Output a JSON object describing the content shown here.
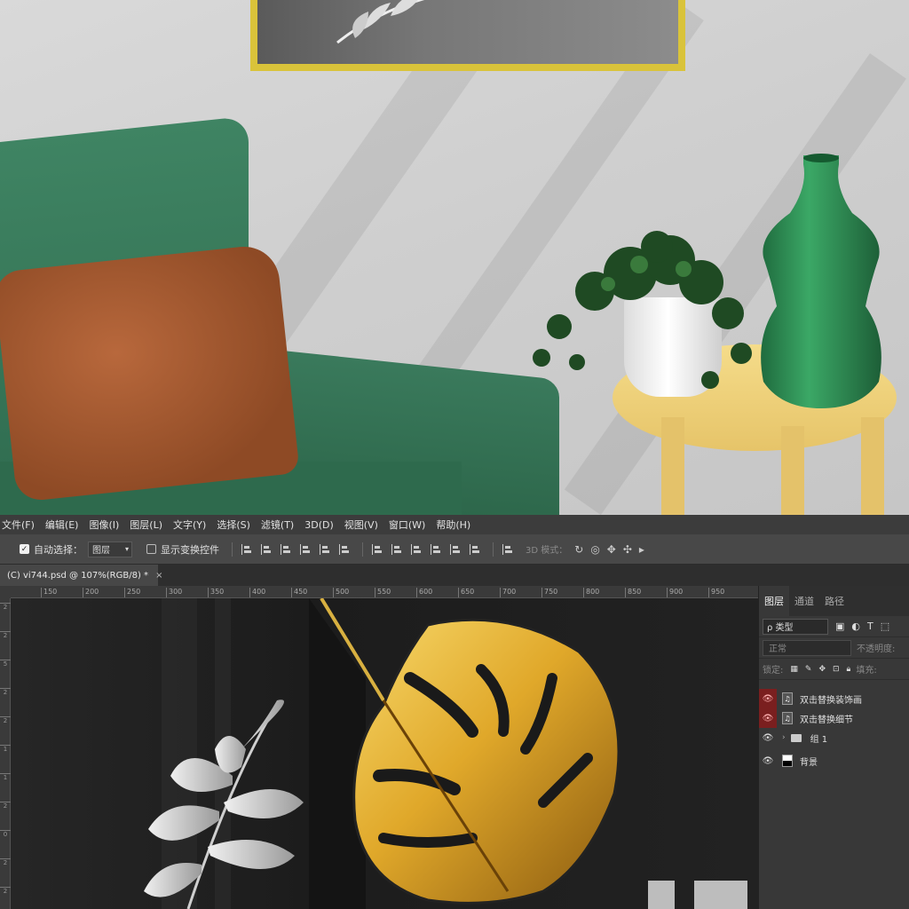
{
  "menu": [
    "文件(F)",
    "编辑(E)",
    "图像(I)",
    "图层(L)",
    "文字(Y)",
    "选择(S)",
    "滤镜(T)",
    "3D(D)",
    "视图(V)",
    "窗口(W)",
    "帮助(H)"
  ],
  "options": {
    "auto_select_label": "自动选择：",
    "auto_select_value": "图层",
    "show_transform_label": "显示变换控件",
    "mode_label": "3D 模式："
  },
  "document_tab": {
    "title": "(C) vi744.psd @ 107%(RGB/8) *",
    "close": "×"
  },
  "ruler": {
    "horizontal": [
      "150",
      "200",
      "250",
      "300",
      "350",
      "400",
      "450",
      "500",
      "550",
      "600",
      "650",
      "700",
      "750",
      "800",
      "850",
      "900",
      "950"
    ],
    "vertical": [
      "2",
      "2",
      "5",
      "2",
      "2",
      "1",
      "1",
      "2",
      "0",
      "2",
      "2"
    ]
  },
  "layers_panel": {
    "tabs": [
      "图层",
      "通道",
      "路径"
    ],
    "filter": "ρ 类型",
    "blend_mode": "正常",
    "opacity_label": "不透明度:",
    "lock_label": "锁定:",
    "fill_label": "填充:",
    "layers": [
      {
        "name": "双击替换装饰画",
        "kind": "smart",
        "highlight": true
      },
      {
        "name": "双击替换细节",
        "kind": "smart",
        "highlight": true
      },
      {
        "name": "组 1",
        "kind": "group",
        "highlight": false
      },
      {
        "name": "背景",
        "kind": "background",
        "highlight": false
      }
    ]
  },
  "colors": {
    "sofa": "#2f6b4f",
    "pillow": "#9a5130",
    "table": "#e9c86f",
    "vase": "#2f8a55",
    "frame": "#d9c33a",
    "gold_leaf": "#e0a82a",
    "ps_menubar": "#3c3c3c",
    "ps_panel": "#383838",
    "eye_highlight": "#7a1f1f"
  }
}
